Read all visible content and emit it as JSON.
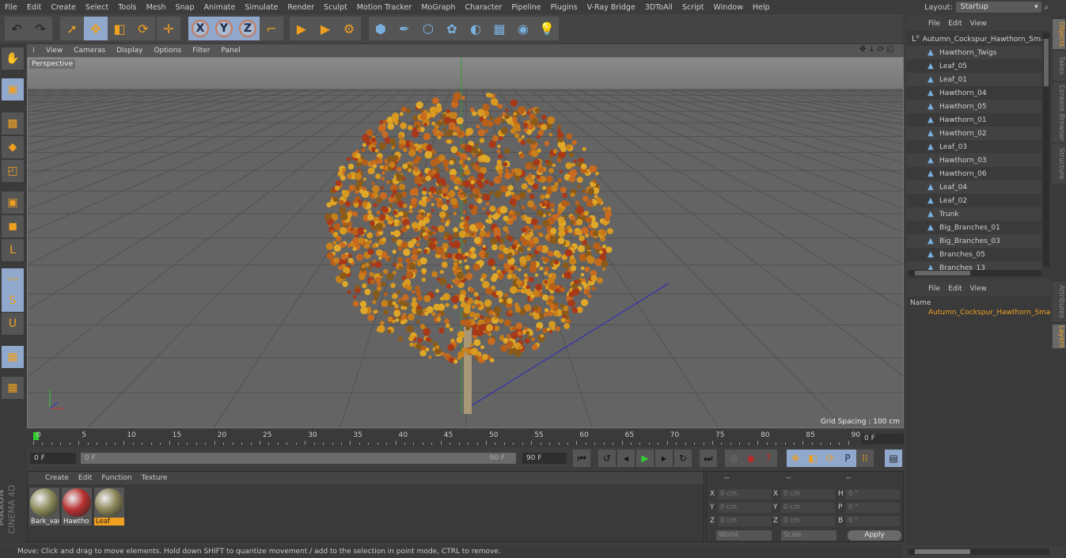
{
  "menubar": [
    "File",
    "Edit",
    "Create",
    "Select",
    "Tools",
    "Mesh",
    "Snap",
    "Animate",
    "Simulate",
    "Render",
    "Sculpt",
    "Motion Tracker",
    "MoGraph",
    "Character",
    "Pipeline",
    "Plugins",
    "V-Ray Bridge",
    "3DToAll",
    "Script",
    "Window",
    "Help"
  ],
  "layout": {
    "label": "Layout:",
    "value": "Startup"
  },
  "toolbar": {
    "icons": [
      "undo-icon",
      "redo-icon",
      "live-selection-icon",
      "move-icon",
      "scale-icon",
      "rotate-icon",
      "transform-icon",
      "x-axis-icon",
      "y-axis-icon",
      "z-axis-icon",
      "coordinate-system-icon",
      "render-view-icon",
      "render-picture-viewer-icon",
      "render-settings-icon",
      "cube-icon",
      "pen-icon",
      "subdivision-icon",
      "cloner-icon",
      "deformer-icon",
      "floor-icon",
      "camera-icon",
      "light-icon"
    ],
    "axis": [
      "X",
      "Y",
      "Z"
    ]
  },
  "viewport": {
    "menu": [
      "View",
      "Cameras",
      "Display",
      "Options",
      "Filter",
      "Panel"
    ],
    "camera": "Perspective",
    "grid_spacing": "Grid Spacing : 100 cm"
  },
  "timeline": {
    "ticks": [
      "0",
      "5",
      "10",
      "15",
      "20",
      "25",
      "30",
      "35",
      "40",
      "45",
      "50",
      "55",
      "60",
      "65",
      "70",
      "75",
      "80",
      "85",
      "90"
    ],
    "current": "0 F",
    "end_field": "0 F",
    "start": "0 F",
    "range_start": "0 F",
    "range_end": "90 F",
    "end": "90 F"
  },
  "materials": {
    "menu": [
      "Create",
      "Edit",
      "Function",
      "Texture"
    ],
    "items": [
      {
        "name": "Bark_var",
        "color": "#8a8a5a"
      },
      {
        "name": "Hawtho",
        "color": "#b83030"
      },
      {
        "name": "Leaf",
        "color": "#8a8458",
        "selected": true
      }
    ]
  },
  "coords": {
    "headers": [
      "--",
      "--",
      "--"
    ],
    "rows": [
      {
        "l1": "X",
        "v1": "0 cm",
        "l2": "X",
        "v2": "0 cm",
        "l3": "H",
        "v3": "0 °"
      },
      {
        "l1": "Y",
        "v1": "0 cm",
        "l2": "Y",
        "v2": "0 cm",
        "l3": "P",
        "v3": "0 °"
      },
      {
        "l1": "Z",
        "v1": "0 cm",
        "l2": "Z",
        "v2": "0 cm",
        "l3": "B",
        "v3": "0 °"
      }
    ],
    "mode": "World",
    "type": "Scale",
    "apply": "Apply"
  },
  "status": "Move: Click and drag to move elements. Hold down SHIFT to quantize movement / add to the selection in point mode, CTRL to remove.",
  "objects": {
    "menu": [
      "File",
      "Edit",
      "View"
    ],
    "root": "Autumn_Cockspur_Hawthorn_Small",
    "items": [
      "Hawthorn_Twigs",
      "Leaf_05",
      "Leaf_01",
      "Hawthorn_04",
      "Hawthorn_05",
      "Hawthorn_01",
      "Hawthorn_02",
      "Leaf_03",
      "Hawthorn_03",
      "Hawthorn_06",
      "Leaf_04",
      "Leaf_02",
      "Trunk",
      "Big_Branches_01",
      "Big_Branches_03",
      "Branches_05",
      "Branches_13"
    ]
  },
  "layers": {
    "menu": [
      "File",
      "Edit",
      "View"
    ],
    "header": "Name",
    "items": [
      {
        "name": "Autumn_Cockspur_Hawthorn_Small",
        "color": "#e8d820"
      }
    ]
  },
  "sidetabs": {
    "top": [
      "Objects",
      "Takes",
      "Content Browser",
      "Structure"
    ],
    "bottom": [
      "Attributes",
      "Layers"
    ]
  },
  "brand": {
    "maxon": "MAXON",
    "cinema": "CINEMA 4D"
  }
}
